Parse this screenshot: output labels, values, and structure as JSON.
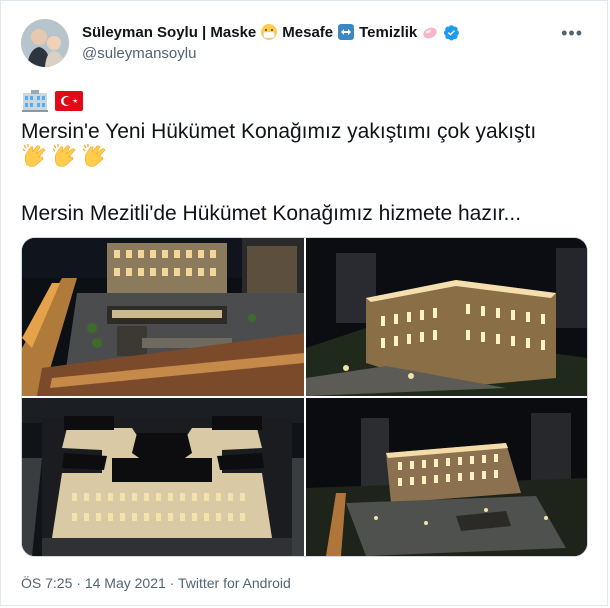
{
  "author": {
    "name": "Süleyman Soylu | Maske",
    "mid1": "Mesafe",
    "mid2": "Temizlik",
    "handle": "@suleymansoylu"
  },
  "icons": {
    "verified": "verified-badge-icon",
    "more": "more-options-icon",
    "mask": "mask-emoji-icon",
    "arrows": "left-right-arrow-emoji-icon",
    "soap": "soap-emoji-icon",
    "building": "building-emoji-icon",
    "flag": "turkey-flag-icon",
    "clap": "clapping-hands-emoji-icon"
  },
  "tweet": {
    "line1": "Mersin'e Yeni Hükümet Konağımız yakıştımı çok yakıştı",
    "line2": "Mersin Mezitli'de Hükümet Konağımız hizmete hazır..."
  },
  "media": {
    "images": [
      "photo-1",
      "photo-2",
      "photo-3",
      "photo-4"
    ]
  },
  "meta": {
    "time": "ÖS 7:25",
    "sep1": " · ",
    "date": "14 May 2021",
    "sep2": " · ",
    "client": "Twitter for Android"
  },
  "colors": {
    "verified": "#1d9bf0",
    "text": "#0f1419",
    "secondary": "#536471"
  }
}
